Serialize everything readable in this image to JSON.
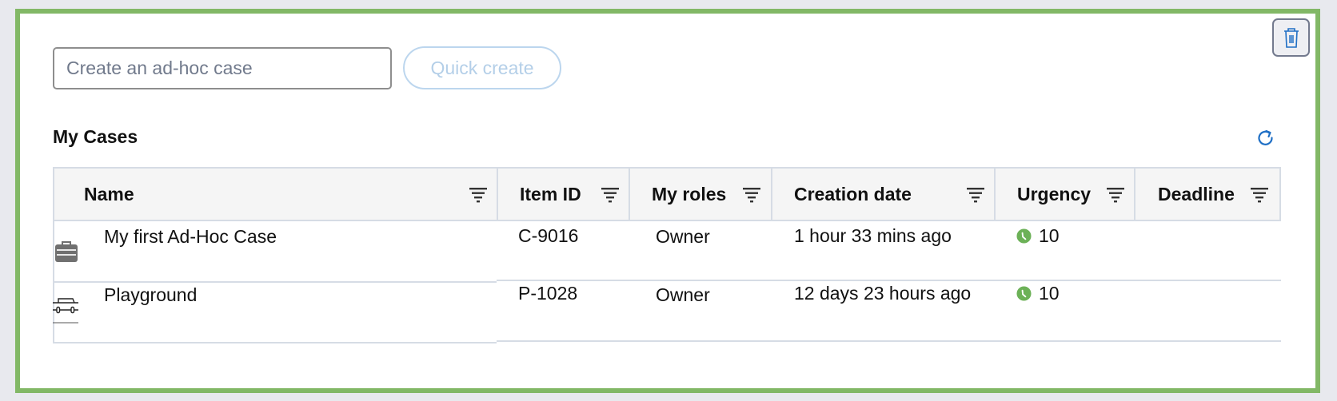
{
  "toolbar": {
    "adhoc_placeholder": "Create an ad-hoc case",
    "adhoc_value": "",
    "quick_create_label": "Quick create",
    "delete_icon": "trash-icon"
  },
  "cases": {
    "title": "My Cases",
    "refresh_icon": "refresh-icon",
    "columns": [
      {
        "label": "Name",
        "filter_icon": "filter-icon"
      },
      {
        "label": "Item ID",
        "filter_icon": "filter-icon"
      },
      {
        "label": "My roles",
        "filter_icon": "filter-icon"
      },
      {
        "label": "Creation date",
        "filter_icon": "filter-icon"
      },
      {
        "label": "Urgency",
        "filter_icon": "filter-icon"
      },
      {
        "label": "Deadline",
        "filter_icon": "filter-icon"
      }
    ],
    "rows": [
      {
        "icon": "briefcase-icon",
        "name": "My first Ad-Hoc Case",
        "item_id": "C-9016",
        "role": "Owner",
        "created": "1 hour 33 mins ago",
        "urgency_icon": "clock-icon",
        "urgency": "10",
        "deadline": ""
      },
      {
        "icon": "toolbox-icon",
        "name": "Playground",
        "item_id": "P-1028",
        "role": "Owner",
        "created": "12 days 23 hours ago",
        "urgency_icon": "clock-icon",
        "urgency": "10",
        "deadline": ""
      }
    ]
  },
  "colors": {
    "panel_border": "#82b866",
    "accent": "#1f6fc5",
    "urgency_ok": "#6cb157"
  }
}
